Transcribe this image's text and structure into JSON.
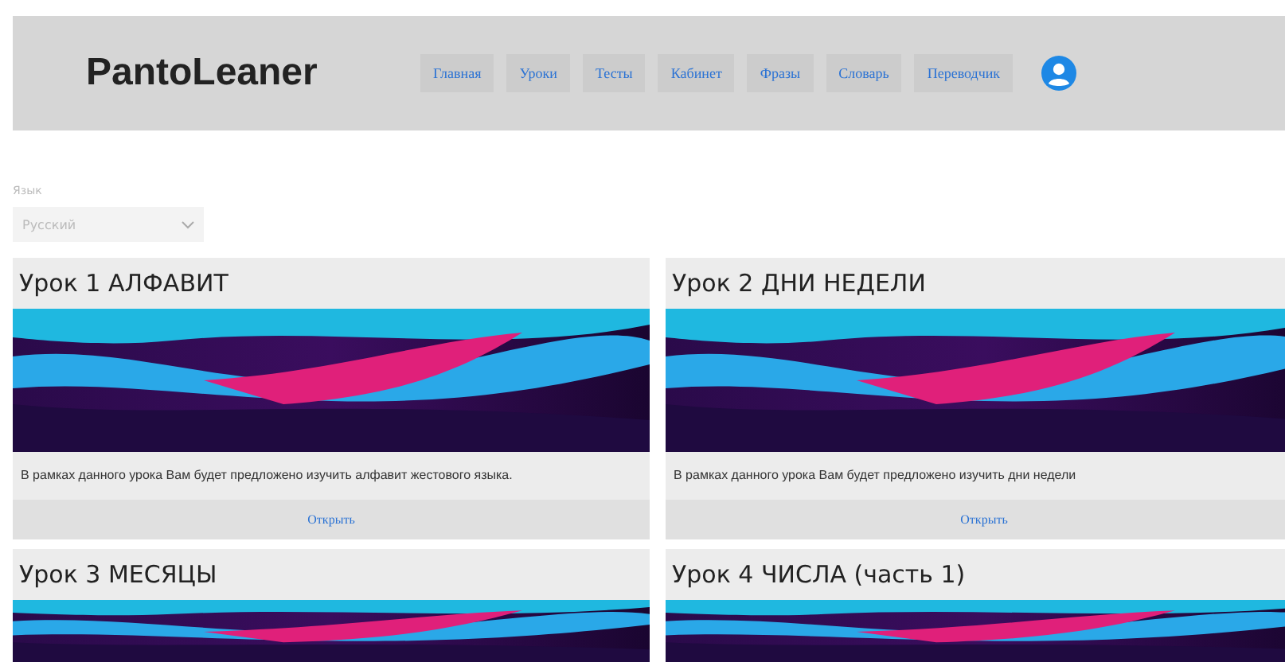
{
  "header": {
    "logo": "PantoLeaner",
    "nav": [
      {
        "label": "Главная"
      },
      {
        "label": "Уроки"
      },
      {
        "label": "Тесты"
      },
      {
        "label": "Кабинет"
      },
      {
        "label": "Фразы"
      },
      {
        "label": "Словарь"
      },
      {
        "label": "Переводчик"
      }
    ]
  },
  "language": {
    "label": "Язык",
    "value": "Русский"
  },
  "lessons": [
    {
      "title": "Урок 1 АЛФАВИТ",
      "description": "В рамках данного урока Вам будет предложено изучить алфавит жестового языка.",
      "button": "Открыть"
    },
    {
      "title": "Урок 2 ДНИ НЕДЕЛИ",
      "description": "В рамках данного урока Вам будет предложено изучить дни недели",
      "button": "Открыть"
    },
    {
      "title": "Урок 3 МЕСЯЦЫ"
    },
    {
      "title": "Урок 4 ЧИСЛА (часть 1)"
    }
  ]
}
